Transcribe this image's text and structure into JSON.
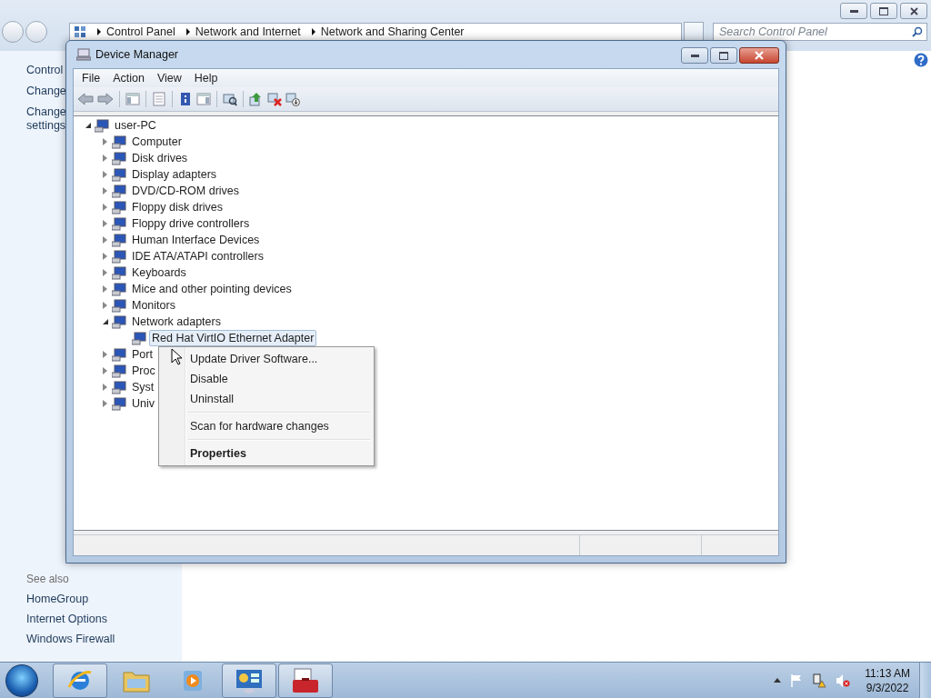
{
  "background_window": {
    "breadcrumbs": [
      "Control Panel",
      "Network and Internet",
      "Network and Sharing Center"
    ],
    "search": {
      "placeholder": "Search Control Panel"
    },
    "sidebar": {
      "items": [
        "Control",
        "Change",
        "Change settings"
      ],
      "see_also": {
        "heading": "See also",
        "links": [
          "HomeGroup",
          "Internet Options",
          "Windows Firewall"
        ]
      }
    }
  },
  "window": {
    "title": "Device Manager",
    "menu": [
      "File",
      "Action",
      "View",
      "Help"
    ],
    "tree": {
      "label": "user-PC",
      "expanded": true,
      "selected": false,
      "children": [
        {
          "label": "Computer",
          "expanded": false,
          "selected": false
        },
        {
          "label": "Disk drives",
          "expanded": false,
          "selected": false
        },
        {
          "label": "Display adapters",
          "expanded": false,
          "selected": false
        },
        {
          "label": "DVD/CD-ROM drives",
          "expanded": false,
          "selected": false
        },
        {
          "label": "Floppy disk drives",
          "expanded": false,
          "selected": false
        },
        {
          "label": "Floppy drive controllers",
          "expanded": false,
          "selected": false
        },
        {
          "label": "Human Interface Devices",
          "expanded": false,
          "selected": false
        },
        {
          "label": "IDE ATA/ATAPI controllers",
          "expanded": false,
          "selected": false
        },
        {
          "label": "Keyboards",
          "expanded": false,
          "selected": false
        },
        {
          "label": "Mice and other pointing devices",
          "expanded": false,
          "selected": false
        },
        {
          "label": "Monitors",
          "expanded": false,
          "selected": false
        },
        {
          "label": "Network adapters",
          "expanded": true,
          "selected": false,
          "children": [
            {
              "label": "Red Hat VirtIO Ethernet Adapter",
              "selected": true
            }
          ]
        },
        {
          "label": "Port",
          "expanded": false,
          "selected": false
        },
        {
          "label": "Proc",
          "expanded": false,
          "selected": false
        },
        {
          "label": "Syst",
          "expanded": false,
          "selected": false
        },
        {
          "label": "Univ",
          "expanded": false,
          "selected": false
        }
      ]
    }
  },
  "context_menu": {
    "items": [
      {
        "kind": "item",
        "label": "Update Driver Software...",
        "default": false
      },
      {
        "kind": "item",
        "label": "Disable",
        "default": false
      },
      {
        "kind": "item",
        "label": "Uninstall",
        "default": false
      },
      {
        "kind": "separator"
      },
      {
        "kind": "item",
        "label": "Scan for hardware changes",
        "default": false
      },
      {
        "kind": "separator"
      },
      {
        "kind": "item",
        "label": "Properties",
        "default": true
      }
    ]
  },
  "taskbar": {
    "apps": [
      {
        "kind": "browser",
        "running": true
      },
      {
        "kind": "folder",
        "running": false
      },
      {
        "kind": "media",
        "running": false
      },
      {
        "kind": "control-panel",
        "running": true
      },
      {
        "kind": "toolbox",
        "running": true
      }
    ],
    "clock": {
      "time": "11:13 AM",
      "date": "9/3/2022"
    }
  }
}
